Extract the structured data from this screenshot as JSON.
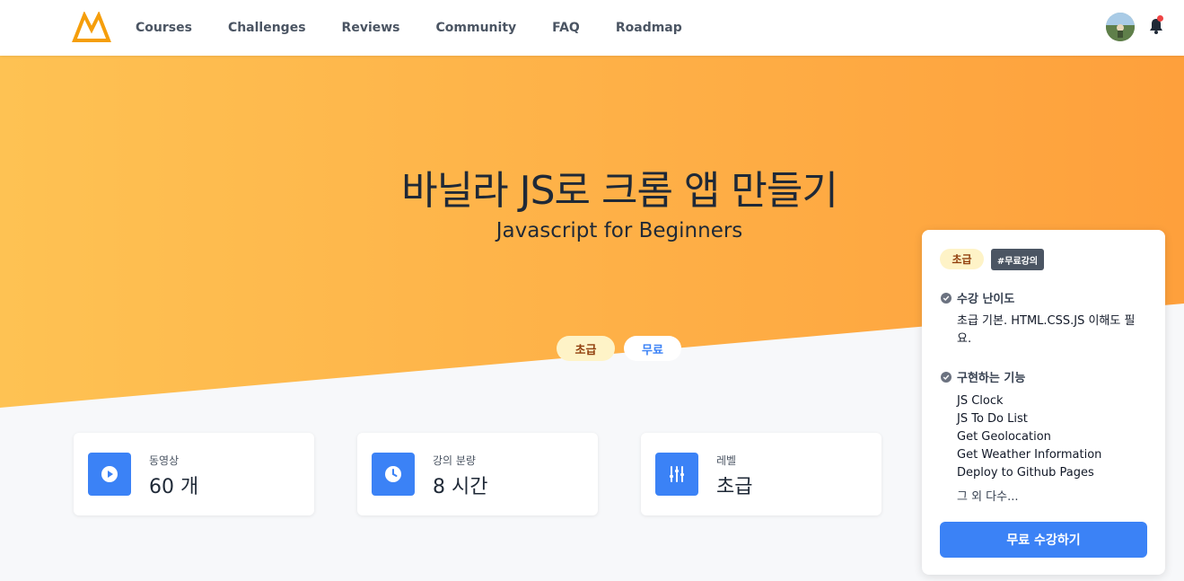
{
  "nav": {
    "links": [
      "Courses",
      "Challenges",
      "Reviews",
      "Community",
      "FAQ",
      "Roadmap"
    ],
    "logo_icon": "nomad-logo-icon",
    "bell_icon": "bell-icon",
    "has_notification": true
  },
  "hero": {
    "title": "바닐라 JS로 크롬 앱 만들기",
    "subtitle": "Javascript for Beginners",
    "pills": {
      "level": "초급",
      "price": "무료"
    },
    "gradient": [
      "#fec253",
      "#fea03c"
    ]
  },
  "stats": [
    {
      "icon": "play-icon",
      "label": "동영상",
      "value": "60 개"
    },
    {
      "icon": "clock-icon",
      "label": "강의 분량",
      "value": "8 시간"
    },
    {
      "icon": "sliders-icon",
      "label": "레벨",
      "value": "초급"
    }
  ],
  "panel": {
    "tag_level": "초급",
    "tag_free": "#무료강의",
    "difficulty": {
      "heading": "수강 난이도",
      "text": "초급 기본. HTML.CSS.JS 이해도 필요."
    },
    "features": {
      "heading": "구현하는 기능",
      "items": [
        "JS Clock",
        "JS To Do List",
        "Get Geolocation",
        "Get Weather Information",
        "Deploy to Github Pages"
      ],
      "more": "그 외 다수..."
    },
    "cta": "무료 수강하기"
  },
  "colors": {
    "accent": "#3b82f6",
    "level_bg": "#fef3c7",
    "level_text": "#92400e",
    "tag_dark": "#4b5563"
  }
}
